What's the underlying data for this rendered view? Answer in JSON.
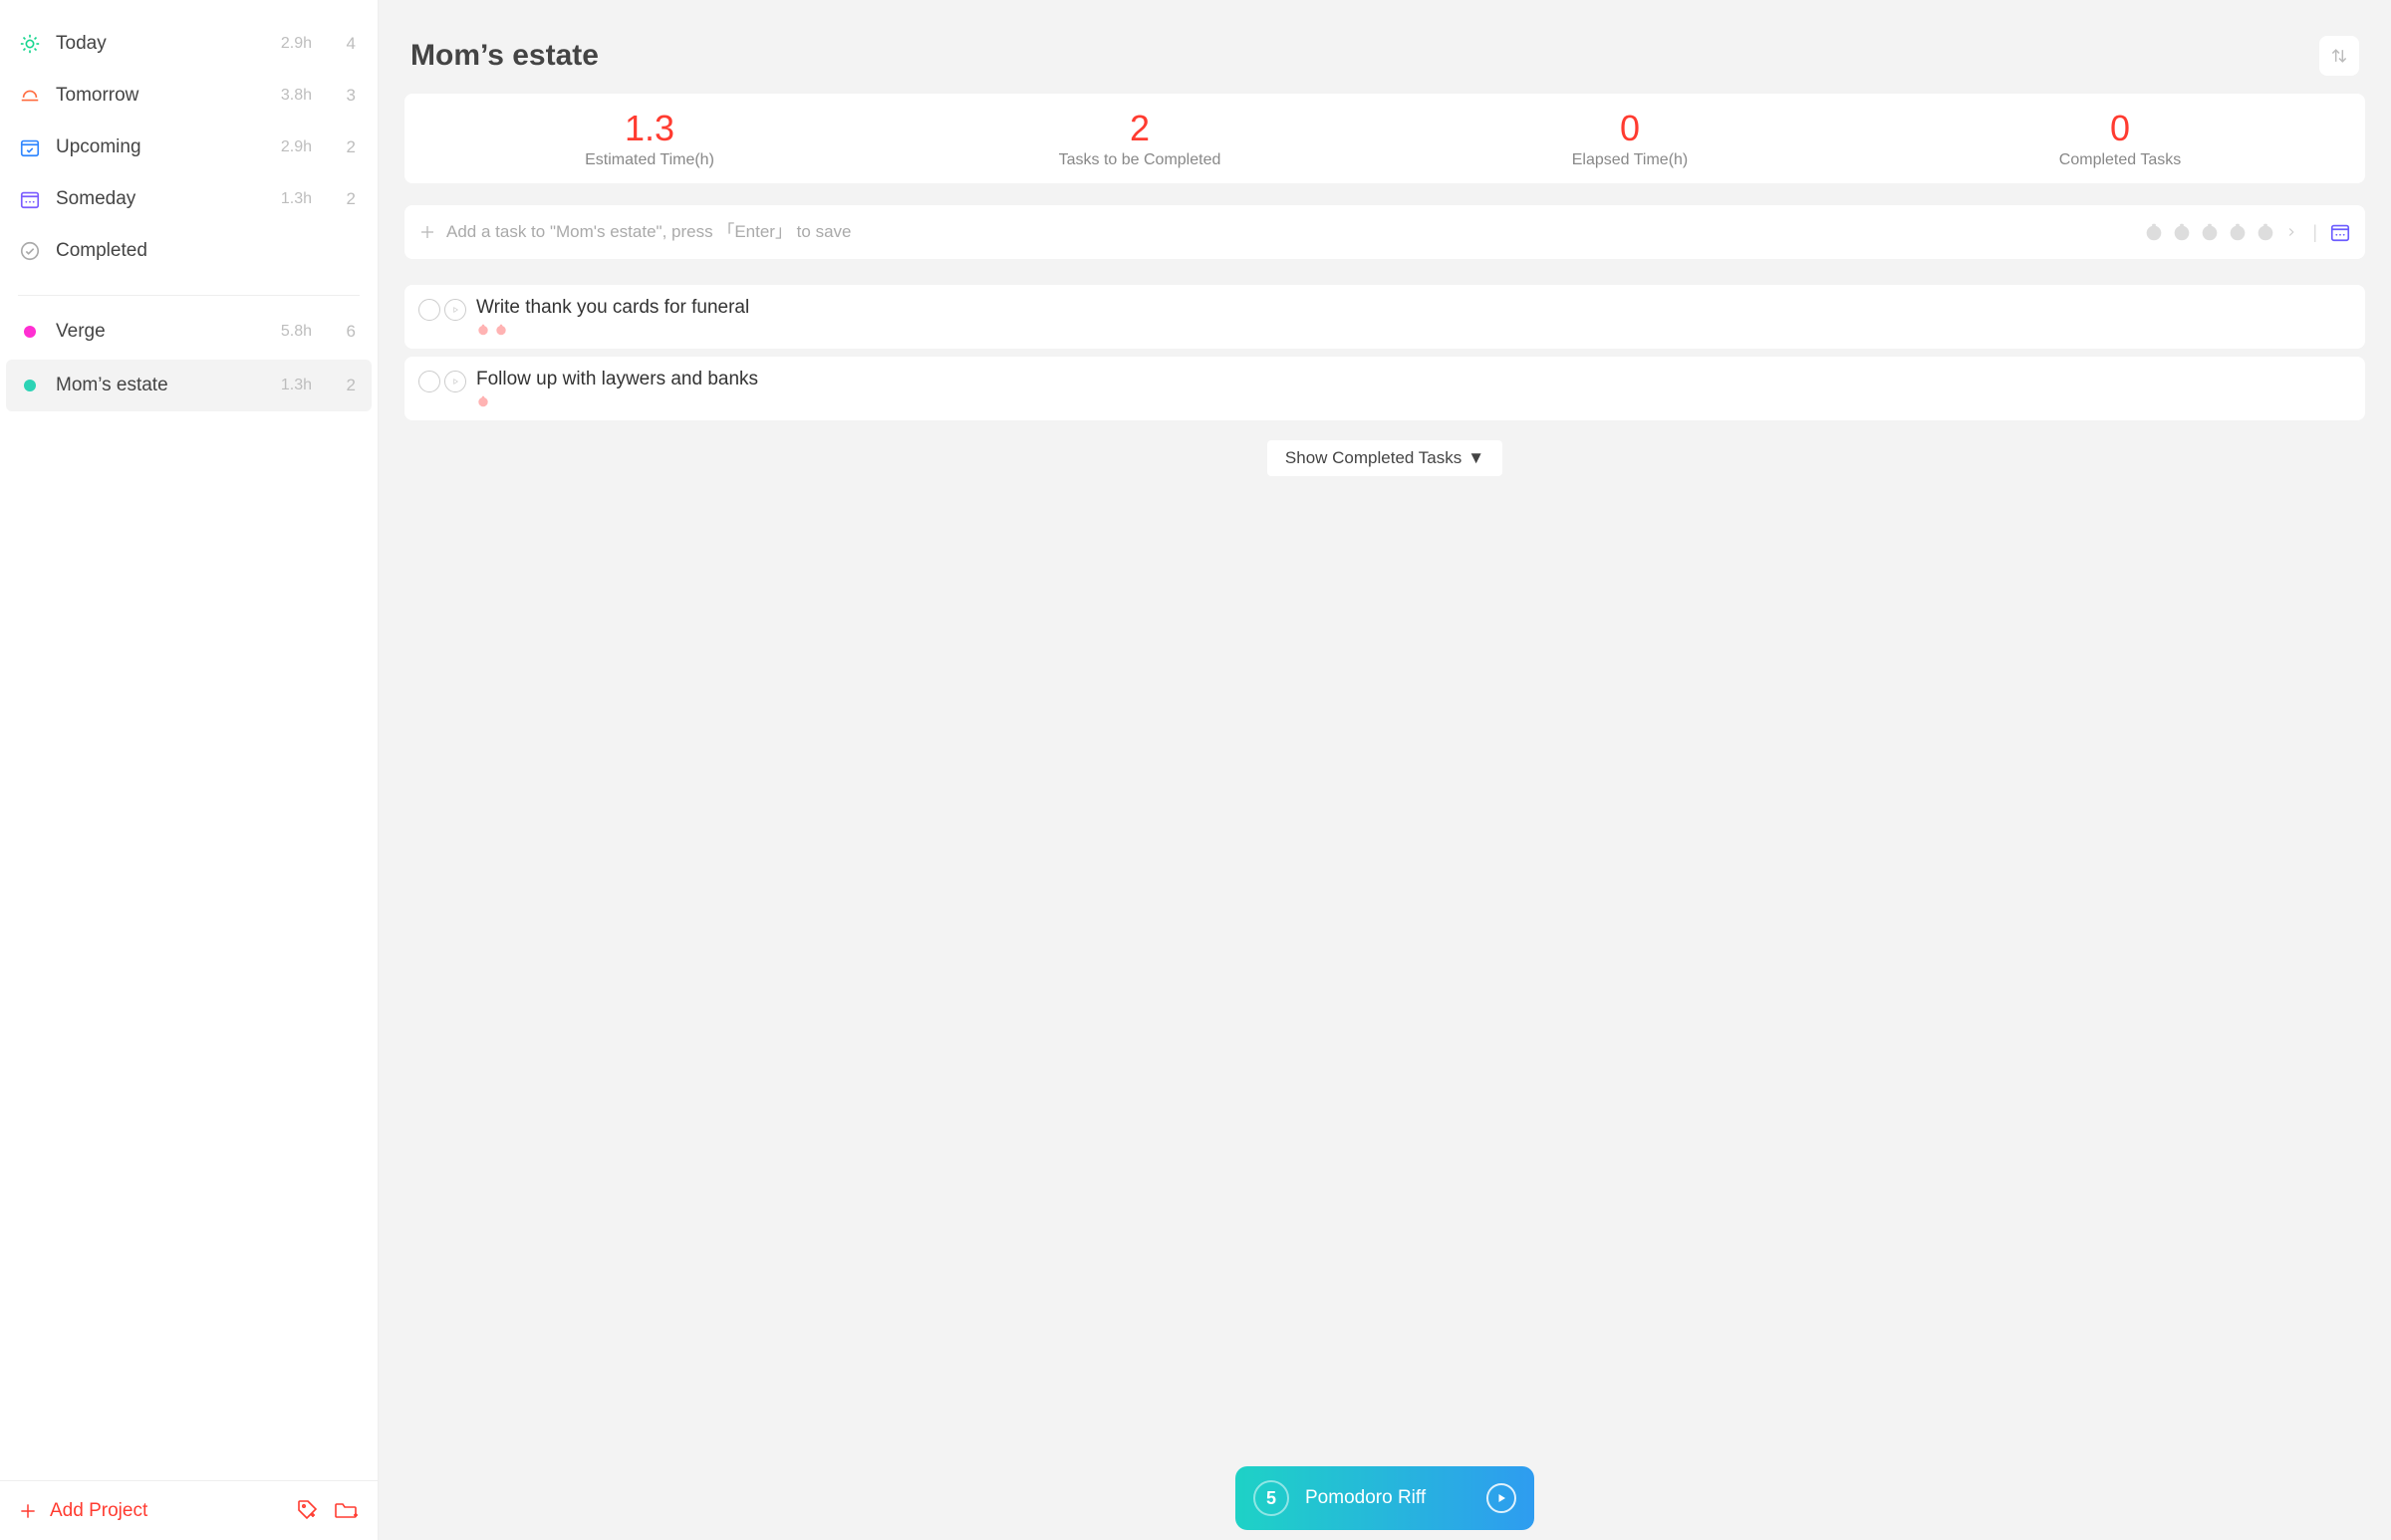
{
  "sidebar": {
    "nav": [
      {
        "key": "today",
        "label": "Today",
        "hours": "2.9h",
        "count": "4"
      },
      {
        "key": "tomorrow",
        "label": "Tomorrow",
        "hours": "3.8h",
        "count": "3"
      },
      {
        "key": "upcoming",
        "label": "Upcoming",
        "hours": "2.9h",
        "count": "2"
      },
      {
        "key": "someday",
        "label": "Someday",
        "hours": "1.3h",
        "count": "2"
      },
      {
        "key": "completed",
        "label": "Completed",
        "hours": "",
        "count": ""
      }
    ],
    "projects": [
      {
        "key": "verge",
        "label": "Verge",
        "color": "#ff2fd2",
        "hours": "5.8h",
        "count": "6",
        "active": false
      },
      {
        "key": "momsestate",
        "label": "Mom’s estate",
        "color": "#2cd3b5",
        "hours": "1.3h",
        "count": "2",
        "active": true
      }
    ],
    "add_project_label": "Add Project"
  },
  "header": {
    "title": "Mom’s estate"
  },
  "summary": [
    {
      "value": "1.3",
      "label": "Estimated Time(h)"
    },
    {
      "value": "2",
      "label": "Tasks to be Completed"
    },
    {
      "value": "0",
      "label": "Elapsed Time(h)"
    },
    {
      "value": "0",
      "label": "Completed Tasks"
    }
  ],
  "add_task": {
    "placeholder": "Add a task to \"Mom's estate\", press 「Enter」 to save"
  },
  "tasks": [
    {
      "title": "Write thank you cards for funeral",
      "pomodoros": 2
    },
    {
      "title": "Follow up with laywers and banks",
      "pomodoros": 1
    }
  ],
  "show_completed_label": "Show Completed Tasks",
  "pomodoro_bar": {
    "count": "5",
    "label": "Pomodoro Riff"
  }
}
